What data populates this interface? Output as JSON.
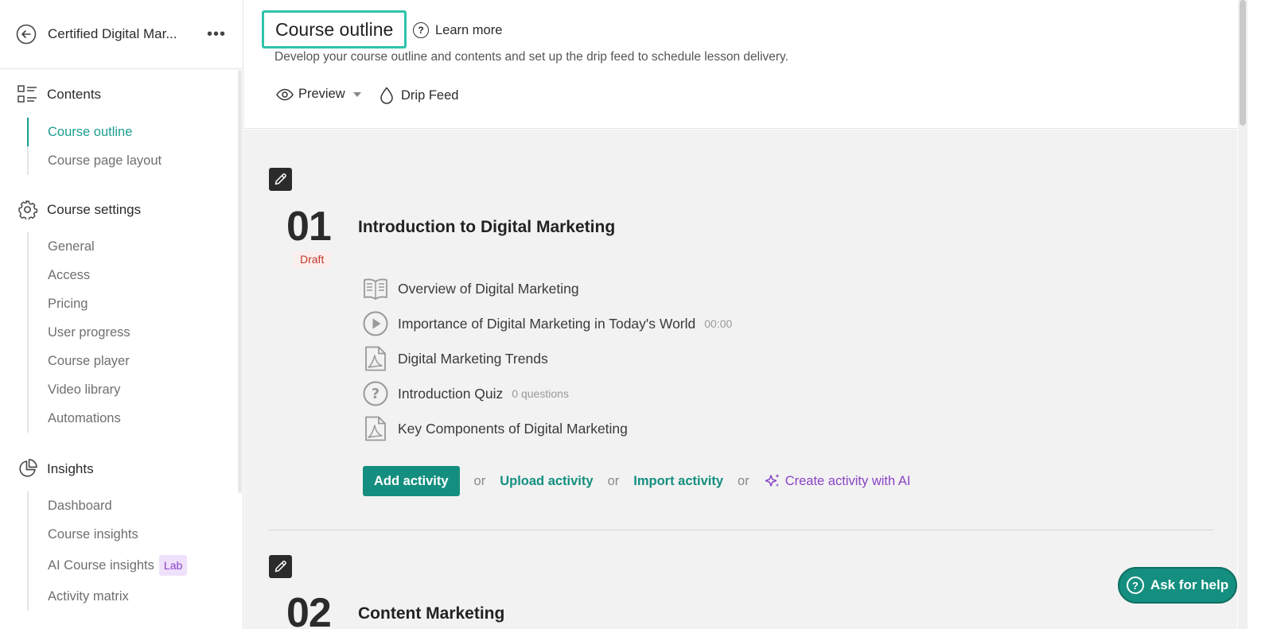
{
  "sidebar": {
    "course_name": "Certified Digital Mar...",
    "more": "•••",
    "contents": {
      "label": "Contents",
      "items": [
        {
          "label": "Course outline"
        },
        {
          "label": "Course page layout"
        }
      ]
    },
    "settings": {
      "label": "Course settings",
      "items": [
        {
          "label": "General"
        },
        {
          "label": "Access"
        },
        {
          "label": "Pricing"
        },
        {
          "label": "User progress"
        },
        {
          "label": "Course player"
        },
        {
          "label": "Video library"
        },
        {
          "label": "Automations"
        }
      ]
    },
    "insights": {
      "label": "Insights",
      "items": [
        {
          "label": "Dashboard"
        },
        {
          "label": "Course insights"
        },
        {
          "label": "AI Course insights",
          "badge": "Lab"
        },
        {
          "label": "Activity matrix"
        }
      ]
    }
  },
  "header": {
    "title": "Course outline",
    "learn_more": "Learn more",
    "subtitle": "Develop your course outline and contents and set up the drip feed to schedule lesson delivery.",
    "preview": "Preview",
    "drip_feed": "Drip Feed"
  },
  "sections": [
    {
      "number": "01",
      "status": "Draft",
      "title": "Introduction to Digital Marketing",
      "activities": [
        {
          "icon": "book-icon",
          "name": "Overview of Digital Marketing",
          "meta": ""
        },
        {
          "icon": "play-icon",
          "name": "Importance of Digital Marketing in Today's World",
          "meta": "00:00"
        },
        {
          "icon": "pdf-icon",
          "name": "Digital Marketing Trends",
          "meta": ""
        },
        {
          "icon": "quiz-icon",
          "name": "Introduction Quiz",
          "meta": "0 questions"
        },
        {
          "icon": "pdf-icon",
          "name": "Key Components of Digital Marketing",
          "meta": ""
        }
      ],
      "actions": {
        "add": "Add activity",
        "or": "or",
        "upload": "Upload activity",
        "import": "Import activity",
        "create_ai": "Create activity with AI"
      }
    },
    {
      "number": "02",
      "title": "Content Marketing"
    }
  ],
  "help": {
    "label": "Ask for help"
  },
  "colors": {
    "accent": "#148f7f",
    "ai": "#8a44c6",
    "draft": "#c0392b"
  }
}
